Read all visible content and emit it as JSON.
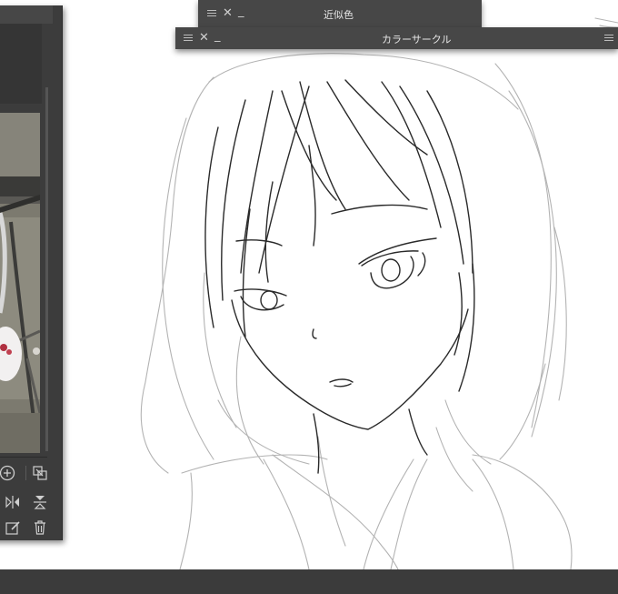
{
  "panels": {
    "similar_color": {
      "title": "近似色",
      "controls": {
        "menu_icon": "menu-icon",
        "close_icon": "close-icon",
        "minimize_icon": "minimize-icon"
      }
    },
    "color_circle": {
      "title": "カラーサークル",
      "controls": {
        "menu_icon": "menu-icon",
        "close_icon": "close-icon",
        "minimize_icon": "minimize-icon"
      }
    }
  },
  "navigator": {
    "tools": [
      {
        "id": "zoom-in",
        "icon": "zoom-in-icon"
      },
      {
        "id": "fit-window",
        "icon": "fit-window-icon"
      },
      {
        "id": "flip-horizontal",
        "icon": "flip-horizontal-icon"
      },
      {
        "id": "flip-vertical",
        "icon": "flip-vertical-icon"
      },
      {
        "id": "edit",
        "icon": "edit-icon"
      },
      {
        "id": "delete",
        "icon": "trash-icon"
      }
    ]
  },
  "colors": {
    "panel_header": "#474747",
    "panel_body": "#3c3c3c",
    "bottom_bar": "#3b3b3b",
    "sketch_line": "#2a2a2a",
    "sketch_rough": "#a5a5a5",
    "canvas": "#ffffff"
  }
}
